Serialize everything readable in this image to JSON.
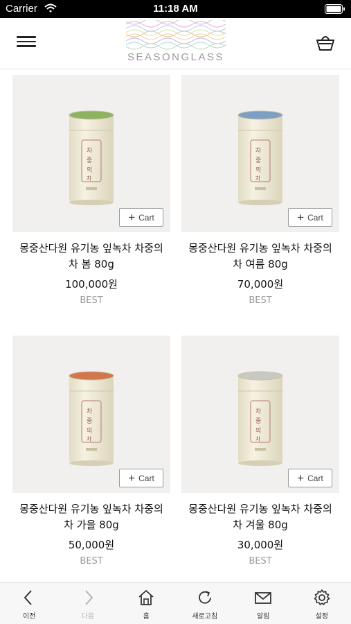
{
  "status_bar": {
    "carrier": "Carrier",
    "time": "11:18 AM"
  },
  "header": {
    "logo_text": "SEASONGLASS"
  },
  "products": [
    {
      "name": "몽중산다원 유기농 잎녹차 차중의 차 봄 80g",
      "price": "100,000원",
      "badge": "BEST",
      "cart_label": "Cart",
      "lid_color": "#8db35e"
    },
    {
      "name": "몽중산다원 유기농 잎녹차 차중의 차 여름 80g",
      "price": "70,000원",
      "badge": "BEST",
      "cart_label": "Cart",
      "lid_color": "#7d9fc4"
    },
    {
      "name": "몽중산다원 유기농 잎녹차 차중의 차 가을 80g",
      "price": "50,000원",
      "badge": "BEST",
      "cart_label": "Cart",
      "lid_color": "#d2764c"
    },
    {
      "name": "몽중산다원 유기농 잎녹차 차중의 차 겨울 80g",
      "price": "30,000원",
      "badge": "BEST",
      "cart_label": "Cart",
      "lid_color": "#c9c9c3"
    }
  ],
  "bottom_nav": [
    {
      "label": "이전",
      "icon": "chevron-left-icon",
      "enabled": true
    },
    {
      "label": "다음",
      "icon": "chevron-right-icon",
      "enabled": false
    },
    {
      "label": "홈",
      "icon": "home-icon",
      "enabled": true
    },
    {
      "label": "새로고침",
      "icon": "refresh-icon",
      "enabled": true
    },
    {
      "label": "알림",
      "icon": "mail-icon",
      "enabled": true
    },
    {
      "label": "설정",
      "icon": "gear-icon",
      "enabled": true
    }
  ]
}
